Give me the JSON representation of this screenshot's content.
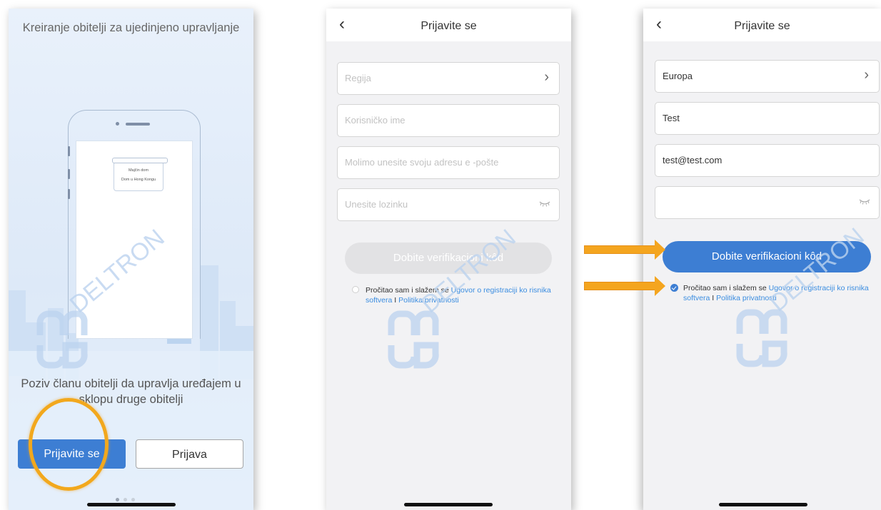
{
  "screen1": {
    "title": "Kreiranje obitelji za ujedinjeno upravljanje",
    "home_card": [
      "Majčin dom",
      "Dom u Hong Kongu"
    ],
    "subtitle": "Poziv članu obitelji da upravlja uređajem u sklopu druge obitelji",
    "primary_button": "Prijavite se",
    "secondary_button": "Prijava",
    "pager_total": 3,
    "pager_active": 1
  },
  "screen2": {
    "nav_title": "Prijavite se",
    "region_placeholder": "Regija",
    "username_placeholder": "Korisničko ime",
    "email_placeholder": "Molimo unesite svoju adresu e -pošte",
    "password_placeholder": "Unesite lozinku",
    "verify_button": "Dobite verifikacioni kôd",
    "agree_text": "Pročitao sam i slažem se ",
    "agree_link1": "Ugovor o registraciji ko risnika softvera",
    "agree_sep": " I ",
    "agree_link2": "Politika privatnosti",
    "agree_checked": false
  },
  "screen3": {
    "nav_title": "Prijavite se",
    "region_value": "Europa",
    "username_value": "Test",
    "email_value": "test@test.com",
    "password_value": "",
    "verify_button": "Dobite verifikacioni kôd",
    "agree_text": "Pročitao sam i slažem se ",
    "agree_link1": "Ugovor o registraciji ko risnika softvera",
    "agree_sep": " I ",
    "agree_link2": "Politika privatnosti",
    "agree_checked": true
  },
  "watermark": {
    "text": "DELTRON"
  },
  "colors": {
    "accent": "#3d7ed3",
    "link": "#3b8de0",
    "highlight": "#f4a51f",
    "watermark": "#bcd3ef"
  }
}
